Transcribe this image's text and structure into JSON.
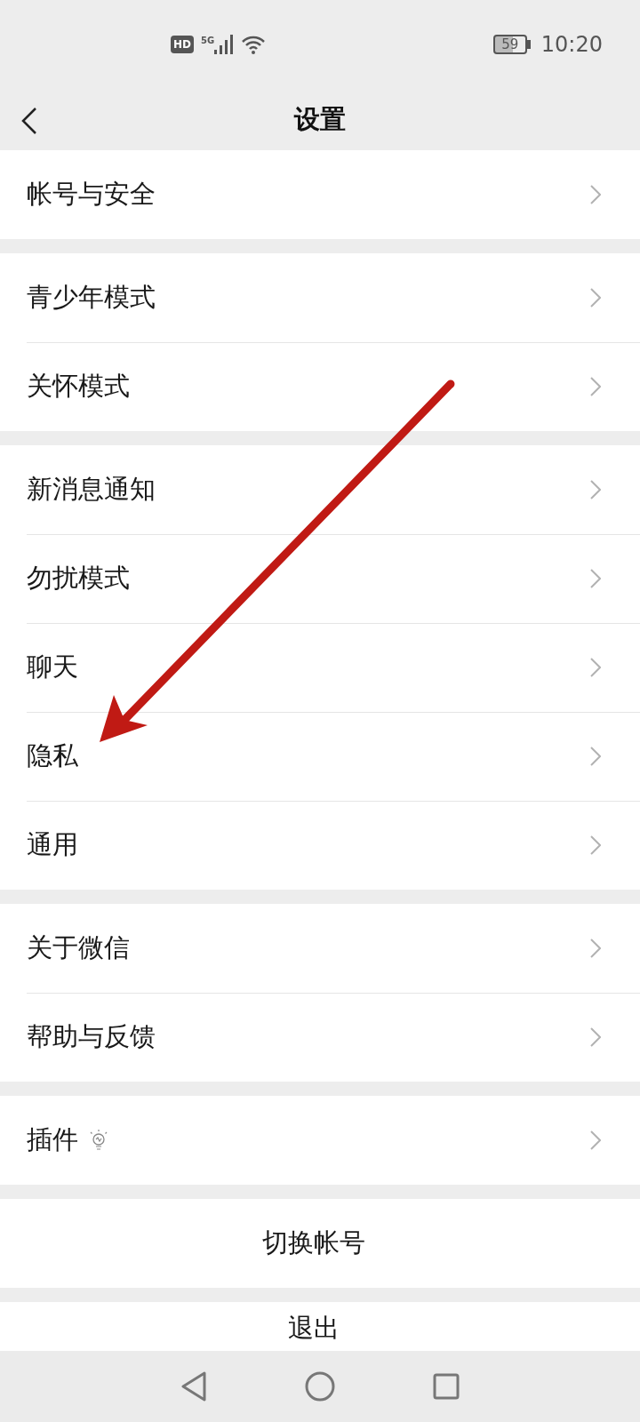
{
  "status_bar": {
    "hd": "HD",
    "network": "5G",
    "battery": "59",
    "time": "10:20"
  },
  "header": {
    "title": "设置"
  },
  "groups": [
    {
      "items": [
        {
          "label": "帐号与安全",
          "kind": "nav"
        }
      ]
    },
    {
      "items": [
        {
          "label": "青少年模式",
          "kind": "nav"
        },
        {
          "label": "关怀模式",
          "kind": "nav"
        }
      ]
    },
    {
      "items": [
        {
          "label": "新消息通知",
          "kind": "nav"
        },
        {
          "label": "勿扰模式",
          "kind": "nav"
        },
        {
          "label": "聊天",
          "kind": "nav"
        },
        {
          "label": "隐私",
          "kind": "nav"
        },
        {
          "label": "通用",
          "kind": "nav"
        }
      ]
    },
    {
      "items": [
        {
          "label": "关于微信",
          "kind": "nav"
        },
        {
          "label": "帮助与反馈",
          "kind": "nav"
        }
      ]
    },
    {
      "items": [
        {
          "label": "插件",
          "kind": "bulb"
        }
      ]
    },
    {
      "items": [
        {
          "label": "切换帐号",
          "kind": "action"
        }
      ]
    },
    {
      "items": [
        {
          "label": "退出",
          "kind": "action"
        }
      ]
    }
  ]
}
